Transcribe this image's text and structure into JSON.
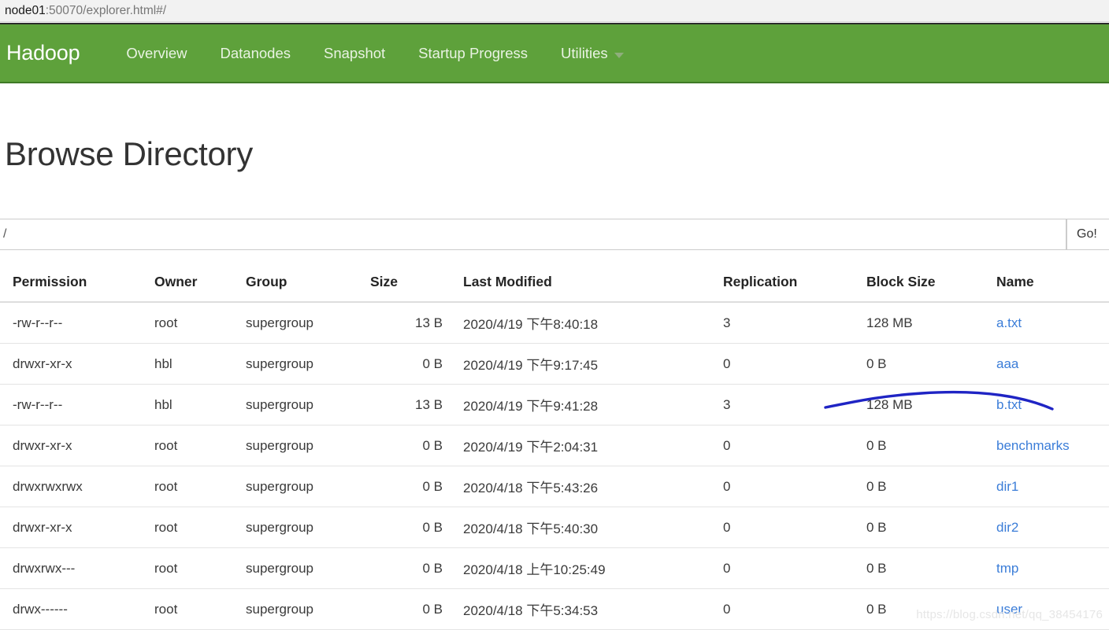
{
  "browser": {
    "url_host": "node01",
    "url_rest": ":50070/explorer.html#/"
  },
  "navbar": {
    "brand": "Hadoop",
    "accent_color": "#5ea13b",
    "items": [
      {
        "label": "Overview"
      },
      {
        "label": "Datanodes"
      },
      {
        "label": "Snapshot"
      },
      {
        "label": "Startup Progress"
      },
      {
        "label": "Utilities",
        "has_caret": true
      }
    ]
  },
  "page": {
    "title": "Browse Directory"
  },
  "path_bar": {
    "value": "/",
    "placeholder": "",
    "go_label": "Go!"
  },
  "table": {
    "columns": [
      "Permission",
      "Owner",
      "Group",
      "Size",
      "Last Modified",
      "Replication",
      "Block Size",
      "Name"
    ],
    "rows": [
      {
        "permission": "-rw-r--r--",
        "owner": "root",
        "group": "supergroup",
        "size": "13 B",
        "last_modified": "2020/4/19 下午8:40:18",
        "replication": "3",
        "block_size": "128 MB",
        "name": "a.txt"
      },
      {
        "permission": "drwxr-xr-x",
        "owner": "hbl",
        "group": "supergroup",
        "size": "0 B",
        "last_modified": "2020/4/19 下午9:17:45",
        "replication": "0",
        "block_size": "0 B",
        "name": "aaa"
      },
      {
        "permission": "-rw-r--r--",
        "owner": "hbl",
        "group": "supergroup",
        "size": "13 B",
        "last_modified": "2020/4/19 下午9:41:28",
        "replication": "3",
        "block_size": "128 MB",
        "name": "b.txt"
      },
      {
        "permission": "drwxr-xr-x",
        "owner": "root",
        "group": "supergroup",
        "size": "0 B",
        "last_modified": "2020/4/19 下午2:04:31",
        "replication": "0",
        "block_size": "0 B",
        "name": "benchmarks"
      },
      {
        "permission": "drwxrwxrwx",
        "owner": "root",
        "group": "supergroup",
        "size": "0 B",
        "last_modified": "2020/4/18 下午5:43:26",
        "replication": "0",
        "block_size": "0 B",
        "name": "dir1"
      },
      {
        "permission": "drwxr-xr-x",
        "owner": "root",
        "group": "supergroup",
        "size": "0 B",
        "last_modified": "2020/4/18 下午5:40:30",
        "replication": "0",
        "block_size": "0 B",
        "name": "dir2"
      },
      {
        "permission": "drwxrwx---",
        "owner": "root",
        "group": "supergroup",
        "size": "0 B",
        "last_modified": "2020/4/18 上午10:25:49",
        "replication": "0",
        "block_size": "0 B",
        "name": "tmp"
      },
      {
        "permission": "drwx------",
        "owner": "root",
        "group": "supergroup",
        "size": "0 B",
        "last_modified": "2020/4/18 下午5:34:53",
        "replication": "0",
        "block_size": "0 B",
        "name": "user"
      }
    ]
  },
  "annotation": {
    "color": "#1f24c4",
    "description": "hand-drawn blue underline curve beneath b.txt row"
  },
  "watermark": {
    "text": "https://blog.csdn.net/qq_38454176"
  }
}
